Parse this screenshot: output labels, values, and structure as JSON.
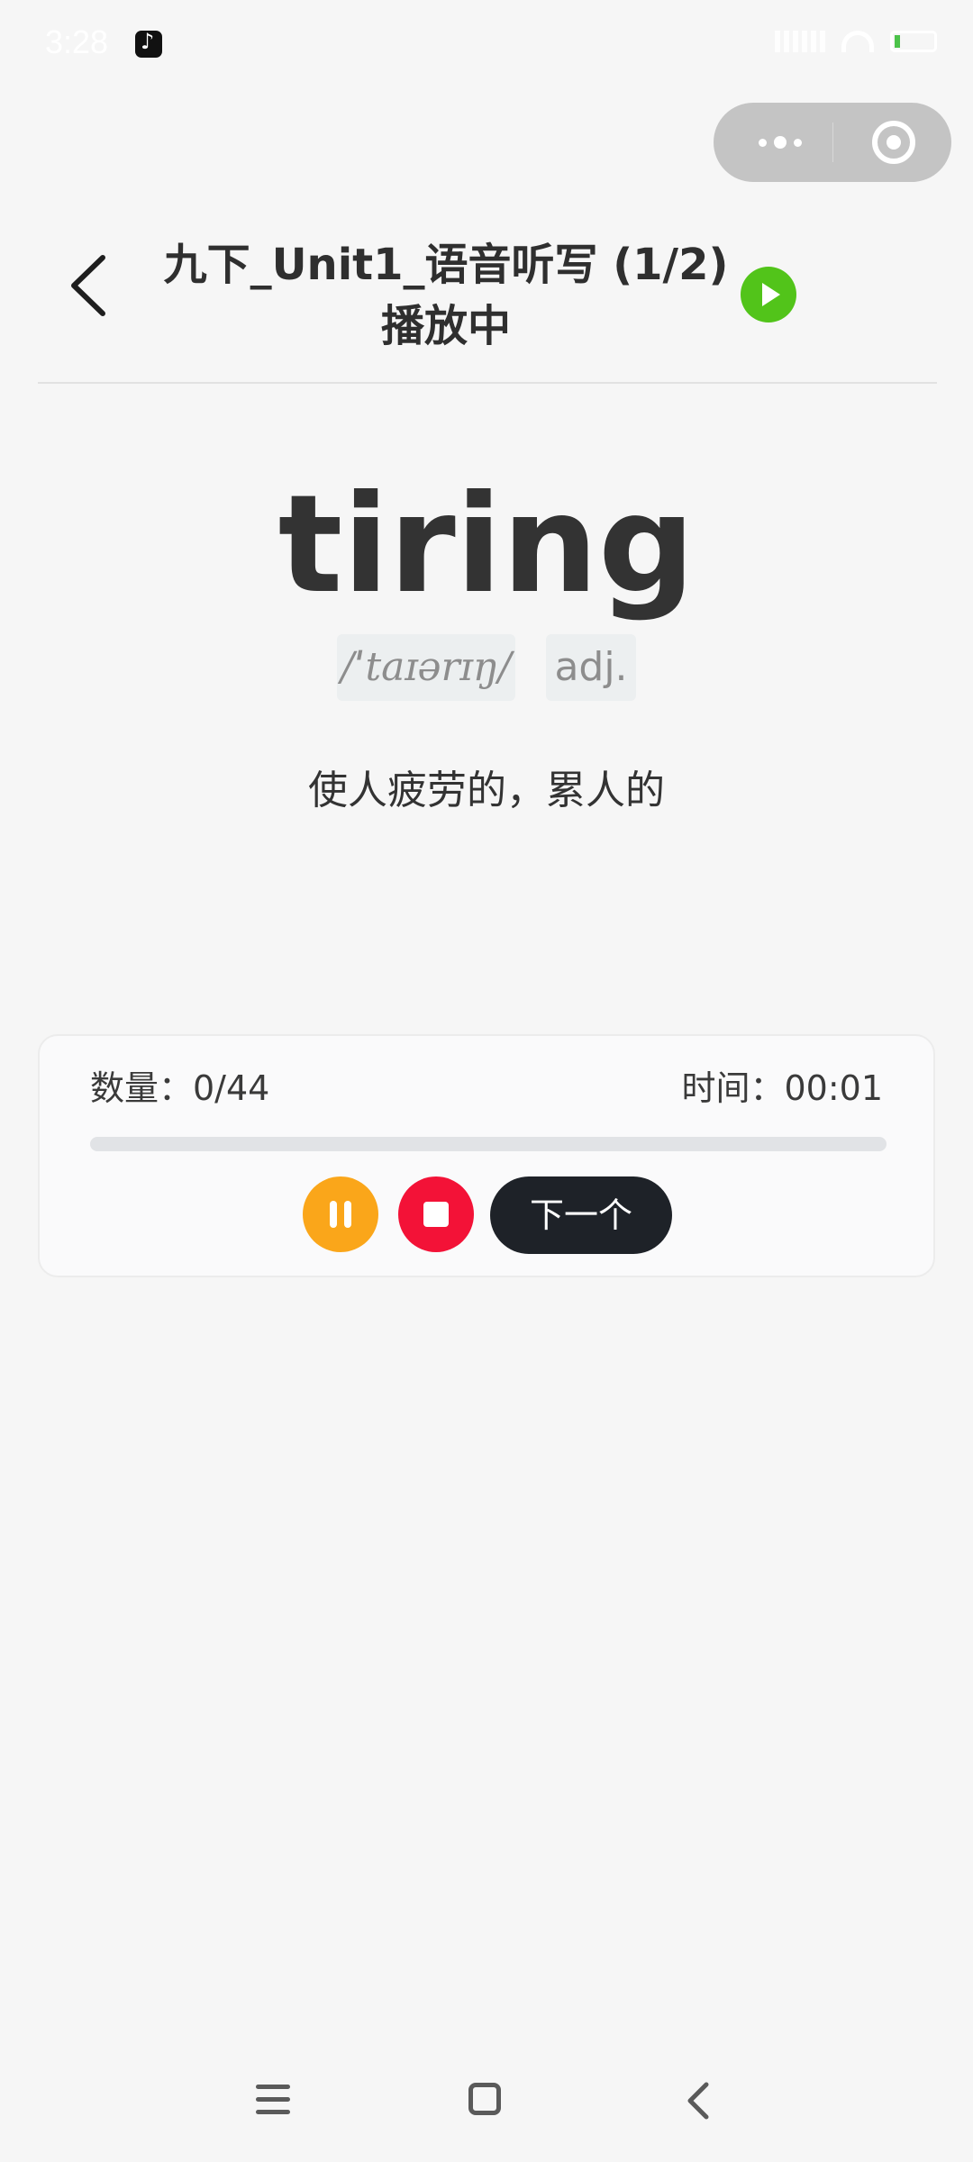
{
  "status_bar": {
    "time": "3:28",
    "app_icon": "tiktok-icon",
    "signal_icon": "signal-icon",
    "wifi_icon": "wifi-icon",
    "battery_icon": "battery-icon"
  },
  "capsule": {
    "more_icon": "more-icon",
    "close_icon": "close-target-icon"
  },
  "header": {
    "back_icon": "chevron-left-icon",
    "title": "九下_Unit1_语音听写 (1/2)",
    "status": "播放中",
    "play_icon": "play-icon",
    "play_icon_color": "#52c41a"
  },
  "word_card": {
    "word": "tiring",
    "phonetic": "/ˈtaɪərɪŋ/",
    "part_of_speech": "adj.",
    "meaning": "使人疲劳的，累人的"
  },
  "controls": {
    "count_label": "数量：0/44",
    "time_label": "时间：00:01",
    "progress_fraction": 0,
    "pause_icon": "pause-icon",
    "pause_color": "#faa61a",
    "stop_icon": "stop-icon",
    "stop_color": "#f31237",
    "next_label": "下一个"
  },
  "nav_bar": {
    "menu_icon": "menu-icon",
    "home_icon": "home-icon",
    "back_icon": "back-icon"
  }
}
